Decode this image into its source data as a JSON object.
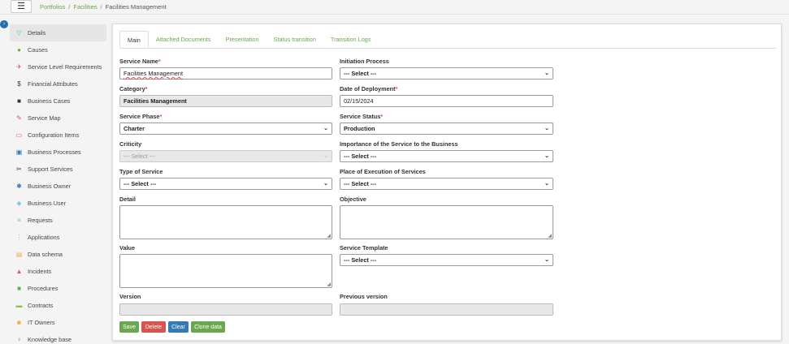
{
  "breadcrumb": [
    "Portfolios",
    "Facilities",
    "Facilities Management"
  ],
  "sidebar": {
    "items": [
      {
        "label": "Details",
        "icon": "filter-icon",
        "color": "#5bc0de"
      },
      {
        "label": "Causes",
        "icon": "circle-icon",
        "color": "#6aa84f"
      },
      {
        "label": "Service Level Requirements",
        "icon": "satellite-icon",
        "color": "#d9534f"
      },
      {
        "label": "Financial Attributes",
        "icon": "dollar-icon",
        "color": "#333333"
      },
      {
        "label": "Business Cases",
        "icon": "briefcase-icon",
        "color": "#333333"
      },
      {
        "label": "Service Map",
        "icon": "pencil-icon",
        "color": "#d9534f"
      },
      {
        "label": "Configuration Items",
        "icon": "monitor-icon",
        "color": "#d9534f"
      },
      {
        "label": "Business Processes",
        "icon": "toolbox-icon",
        "color": "#337ab7"
      },
      {
        "label": "Support Services",
        "icon": "wrench-icon",
        "color": "#333333"
      },
      {
        "label": "Business Owner",
        "icon": "gear-icon",
        "color": "#337ab7"
      },
      {
        "label": "Business User",
        "icon": "shield-icon",
        "color": "#5bc0de"
      },
      {
        "label": "Requests",
        "icon": "list-icon",
        "color": "#5bc0de"
      },
      {
        "label": "Applications",
        "icon": "grid-icon",
        "color": "#f0ad4e"
      },
      {
        "label": "Data schema",
        "icon": "file-icon",
        "color": "#f0ad4e"
      },
      {
        "label": "Incidents",
        "icon": "warning-icon",
        "color": "#d9534f"
      },
      {
        "label": "Procedures",
        "icon": "folder-icon",
        "color": "#6aa84f"
      },
      {
        "label": "Contracts",
        "icon": "folder-open-icon",
        "color": "#8bc34a"
      },
      {
        "label": "IT Owners",
        "icon": "users-icon",
        "color": "#f0ad4e"
      },
      {
        "label": "Knowledge base",
        "icon": "bulb-icon",
        "color": "#d9534f"
      }
    ]
  },
  "tabs": [
    "Main",
    "Attached Documents",
    "Presentation",
    "Status transition",
    "Transition Logs"
  ],
  "form": {
    "service_name": {
      "label": "Service Name",
      "value": "Facilities Management"
    },
    "initiation_process": {
      "label": "Initiation Process",
      "value": "--- Select ---"
    },
    "category": {
      "label": "Category",
      "value": "Facilities Management"
    },
    "date_of_deployment": {
      "label": "Date of Deployment",
      "value": "02/15/2024"
    },
    "service_phase": {
      "label": "Service Phase",
      "value": "Charter"
    },
    "service_status": {
      "label": "Service Status",
      "value": "Production"
    },
    "criticity": {
      "label": "Criticity",
      "value": "--- Select ---"
    },
    "importance": {
      "label": "Importance of the Service to the Business",
      "value": "--- Select ---"
    },
    "type_of_service": {
      "label": "Type of Service",
      "value": "--- Select ---"
    },
    "place_of_execution": {
      "label": "Place of Execution of Services",
      "value": "--- Select ---"
    },
    "detail": {
      "label": "Detail"
    },
    "objective": {
      "label": "Objective"
    },
    "value": {
      "label": "Value"
    },
    "service_template": {
      "label": "Service Template",
      "value": "--- Select ---"
    },
    "version": {
      "label": "Version"
    },
    "previous_version": {
      "label": "Previous version"
    }
  },
  "buttons": {
    "save": "Save",
    "delete": "Delete",
    "clear": "Clear",
    "clone": "Clone data"
  },
  "colors": {
    "accent_green": "#6aa84f",
    "danger": "#d9534f",
    "primary": "#337ab7"
  }
}
